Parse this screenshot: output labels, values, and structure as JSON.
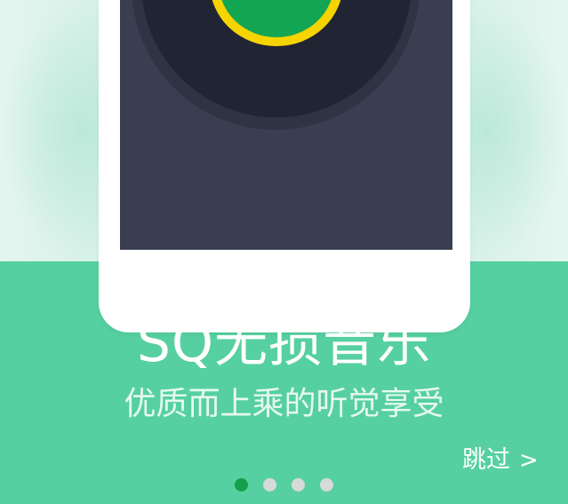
{
  "splash": {
    "title": "SQ无损音乐",
    "subtitle": "优质而上乘的听觉享受",
    "skip_label": "跳过",
    "skip_icon": "chevron-right-icon",
    "skip_glyph": ">"
  },
  "pagination": {
    "total": 4,
    "active_index": 0
  },
  "colors": {
    "accent_green": "#56d0a0",
    "active_dot": "#14a04a",
    "inactive_dot": "#d6dad8",
    "vinyl_label_green": "#12a552",
    "vinyl_ring_yellow": "#f5d400",
    "phone_screen": "#393e50"
  }
}
